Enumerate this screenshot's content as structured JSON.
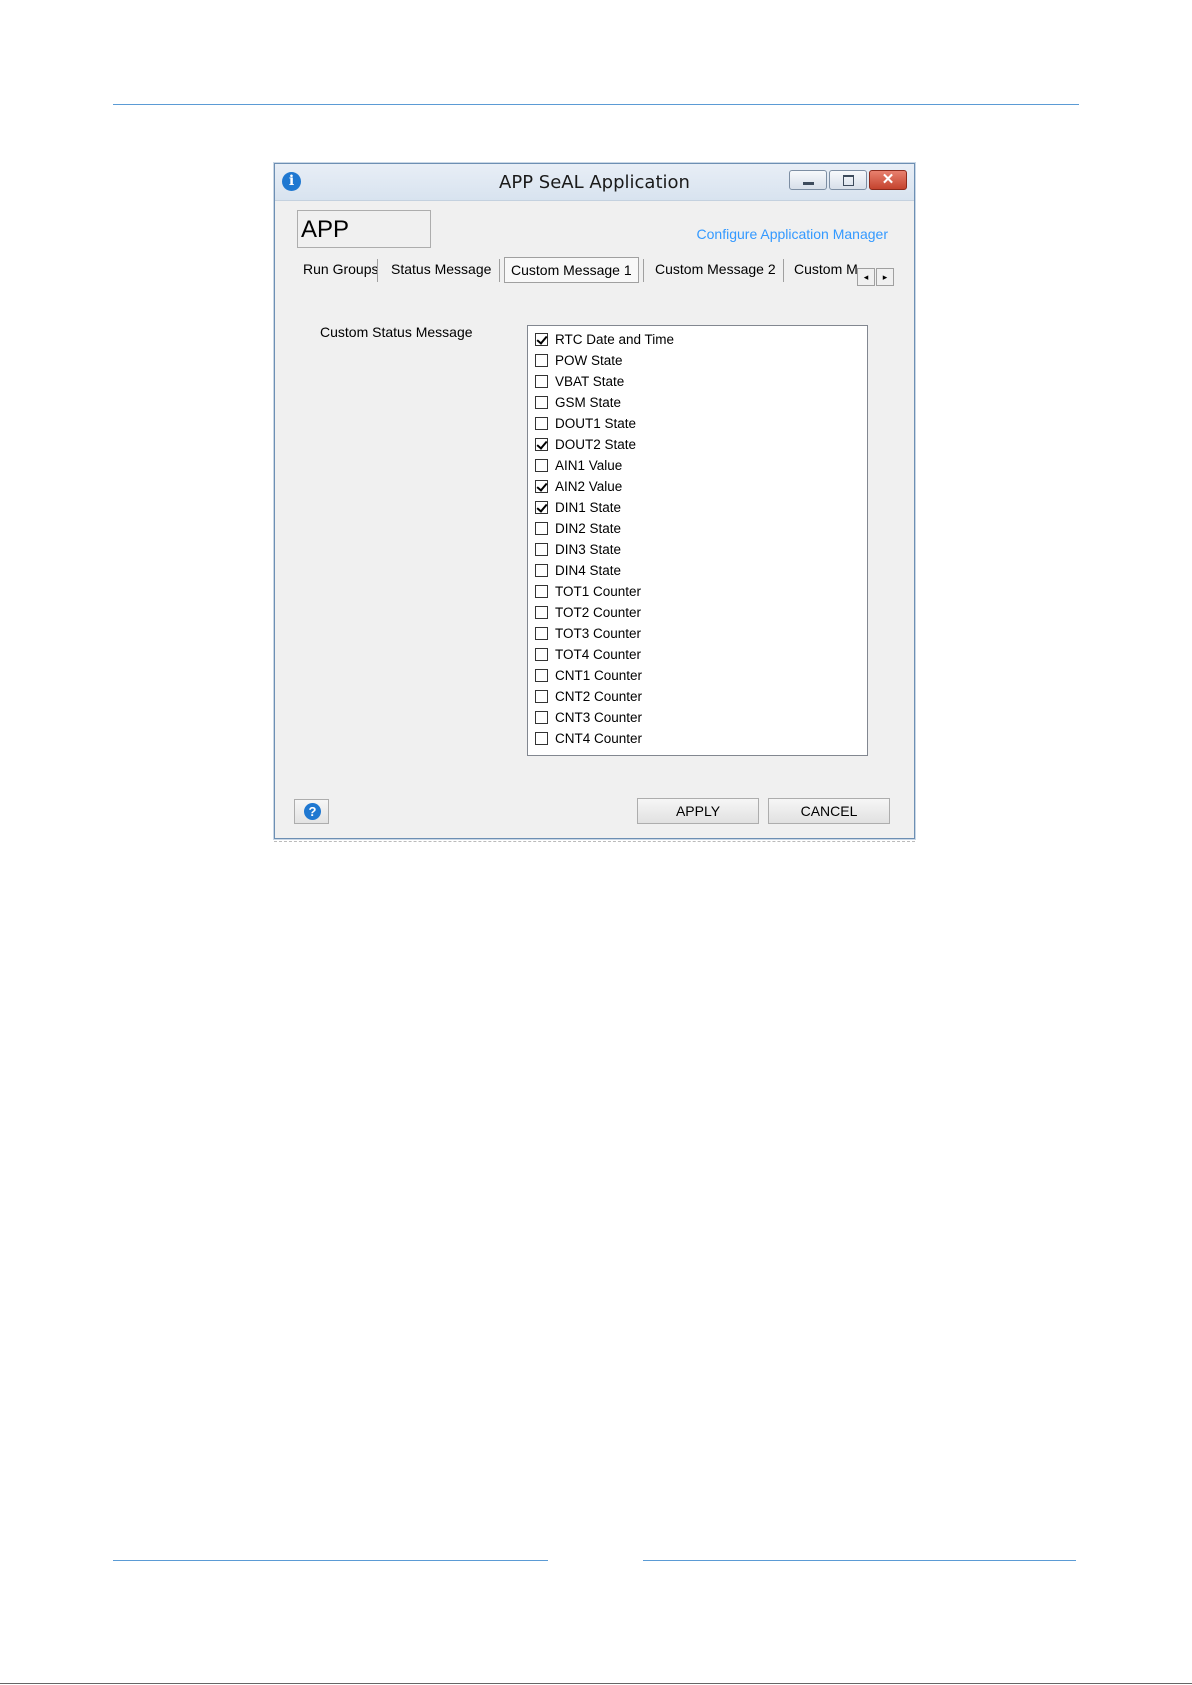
{
  "window": {
    "title": "APP SeAL Application",
    "close_glyph": "✕",
    "title_icon": "i"
  },
  "app_name": "APP",
  "config_link": "Configure Application Manager",
  "tabs": [
    {
      "label": "Run Groups",
      "active": false
    },
    {
      "label": "Status Message",
      "active": false
    },
    {
      "label": "Custom Message 1",
      "active": true
    },
    {
      "label": "Custom Message 2",
      "active": false
    },
    {
      "label": "Custom M",
      "active": false
    }
  ],
  "tab_scroll": {
    "left": "◂",
    "right": "▸"
  },
  "field_label": "Custom Status Message",
  "items": [
    {
      "label": "RTC Date and Time",
      "checked": true
    },
    {
      "label": "POW State",
      "checked": false
    },
    {
      "label": "VBAT State",
      "checked": false
    },
    {
      "label": "GSM State",
      "checked": false
    },
    {
      "label": "DOUT1 State",
      "checked": false
    },
    {
      "label": "DOUT2 State",
      "checked": true
    },
    {
      "label": "AIN1 Value",
      "checked": false
    },
    {
      "label": "AIN2 Value",
      "checked": true
    },
    {
      "label": "DIN1 State",
      "checked": true
    },
    {
      "label": "DIN2 State",
      "checked": false
    },
    {
      "label": "DIN3 State",
      "checked": false
    },
    {
      "label": "DIN4 State",
      "checked": false
    },
    {
      "label": "TOT1 Counter",
      "checked": false
    },
    {
      "label": "TOT2 Counter",
      "checked": false
    },
    {
      "label": "TOT3 Counter",
      "checked": false
    },
    {
      "label": "TOT4 Counter",
      "checked": false
    },
    {
      "label": "CNT1 Counter",
      "checked": false
    },
    {
      "label": "CNT2 Counter",
      "checked": false
    },
    {
      "label": "CNT3 Counter",
      "checked": false
    },
    {
      "label": "CNT4 Counter",
      "checked": false
    }
  ],
  "help_glyph": "?",
  "buttons": {
    "apply": "APPLY",
    "cancel": "CANCEL"
  },
  "colors": {
    "link": "#3399ff",
    "accent_rule": "#5b9bd5",
    "close": "#c4432e"
  }
}
